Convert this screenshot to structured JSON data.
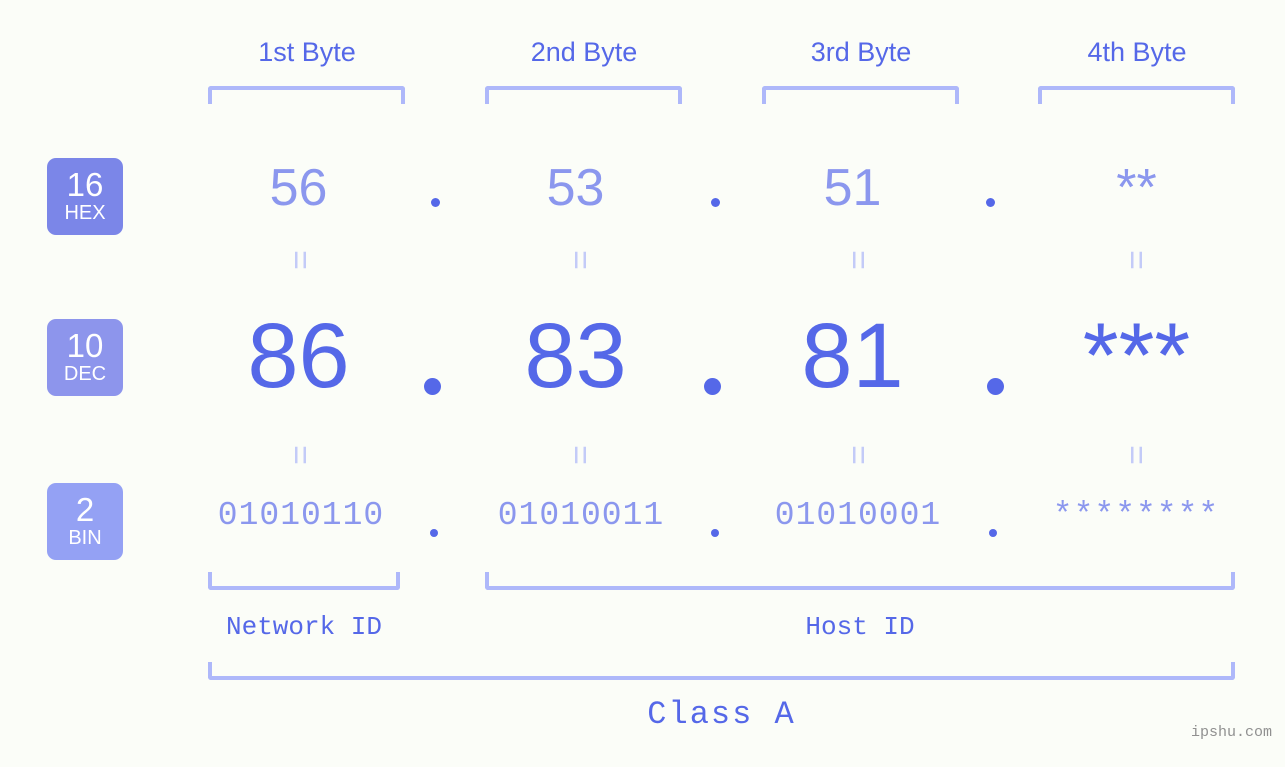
{
  "page": {
    "background_color": "#fbfdf8",
    "accent_color": "#5568e8",
    "light_accent_color": "#8b97ee",
    "bracket_color": "#aeb8fa",
    "watermark": "ipshu.com"
  },
  "columns": [
    {
      "label": "1st Byte"
    },
    {
      "label": "2nd Byte"
    },
    {
      "label": "3rd Byte"
    },
    {
      "label": "4th Byte"
    }
  ],
  "rows": [
    {
      "key": "hex",
      "badge_number": "16",
      "badge_abbr": "HEX",
      "badge_color": "#7b86e8",
      "values": [
        "56",
        "53",
        "51",
        "**"
      ],
      "separators": [
        ".",
        ".",
        "."
      ]
    },
    {
      "key": "dec",
      "badge_number": "10",
      "badge_abbr": "DEC",
      "badge_color": "#8d95ec",
      "values": [
        "86",
        "83",
        "81",
        "***"
      ],
      "separators": [
        ".",
        ".",
        "."
      ]
    },
    {
      "key": "bin",
      "badge_number": "2",
      "badge_abbr": "BIN",
      "badge_color": "#94a1f4",
      "values": [
        "01010110",
        "01010011",
        "01010001",
        "********"
      ],
      "separators": [
        ".",
        ".",
        "."
      ]
    }
  ],
  "equals_marks": {
    "glyph": "=",
    "count_per_row": 4
  },
  "regions": [
    {
      "label": "Network ID"
    },
    {
      "label": "Host ID"
    }
  ],
  "class": {
    "label": "Class A"
  }
}
